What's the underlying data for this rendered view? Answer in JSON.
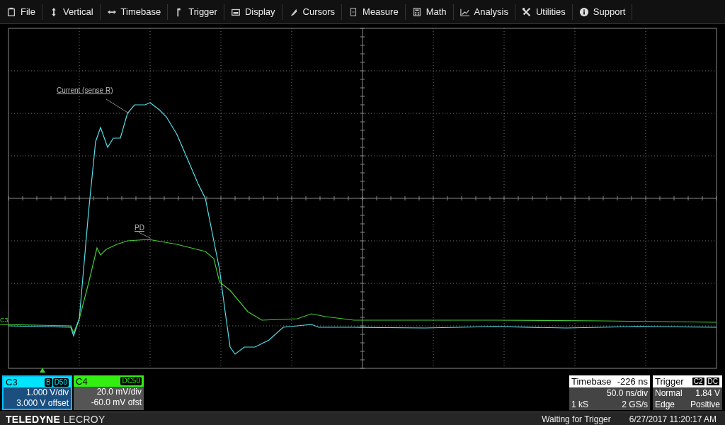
{
  "menu": [
    {
      "label": "File"
    },
    {
      "label": "Vertical"
    },
    {
      "label": "Timebase"
    },
    {
      "label": "Trigger"
    },
    {
      "label": "Display"
    },
    {
      "label": "Cursors"
    },
    {
      "label": "Measure"
    },
    {
      "label": "Math"
    },
    {
      "label": "Analysis"
    },
    {
      "label": "Utilities"
    },
    {
      "label": "Support"
    }
  ],
  "display": {
    "ground_marker": "C3",
    "trace_labels": [
      {
        "text": "Current (sense R)"
      },
      {
        "text": "PD"
      }
    ]
  },
  "channels": [
    {
      "name": "C3",
      "color": "#00e5ff",
      "selected": true,
      "badges": [
        "B",
        "D50"
      ],
      "scale": "1.000 V/div",
      "offset": "3.000 V offset"
    },
    {
      "name": "C4",
      "color": "#33ee11",
      "selected": false,
      "badges": [
        "DC50"
      ],
      "scale": "20.0 mV/div",
      "offset": "-60.0 mV ofst"
    }
  ],
  "timebase": {
    "title": "Timebase",
    "delay": "-226 ns",
    "rate": "50.0 ns/div",
    "samples": "1 kS",
    "sample_rate": "2 GS/s"
  },
  "trigger": {
    "title": "Trigger",
    "badges": [
      "C2",
      "DC"
    ],
    "mode": "Normal",
    "level": "1.84 V",
    "type": "Edge",
    "slope": "Positive"
  },
  "status_bar": {
    "brand_bold": "TELEDYNE",
    "brand": "LECROY",
    "status": "Waiting for Trigger",
    "datetime": "6/27/2017 11:20:17 AM"
  }
}
